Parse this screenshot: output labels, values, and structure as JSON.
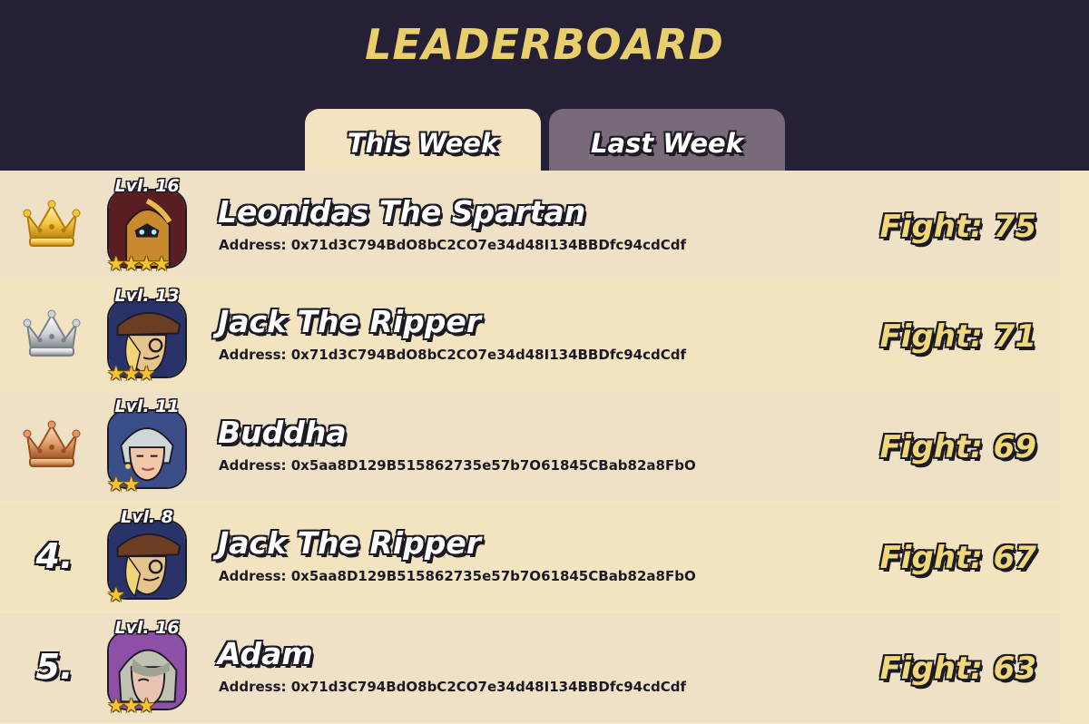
{
  "title": "LEADERBOARD",
  "tabs": {
    "this_week": "This Week",
    "last_week": "Last Week",
    "active": "this_week"
  },
  "colors": {
    "gold": "#e9cf6c",
    "silver": "#cfd3d8",
    "bronze": "#d9894f",
    "dark": "#252036"
  },
  "rows": [
    {
      "rank": "1",
      "crown": "gold-crown-icon",
      "level": "Lvl. 16",
      "stars": 4,
      "avatar": "spartan-helmet-avatar",
      "avatar_bg": "#5a1d22",
      "name": "Leonidas The Spartan",
      "address": "Address: 0x71d3C794BdO8bC2CO7e34d48I134BBDfc94cdCdf",
      "fight": "Fight: 75"
    },
    {
      "rank": "2",
      "crown": "silver-crown-icon",
      "level": "Lvl. 13",
      "stars": 3,
      "avatar": "ripper-avatar",
      "avatar_bg": "#29336a",
      "name": "Jack The Ripper",
      "address": "Address: 0x71d3C794BdO8bC2CO7e34d48I134BBDfc94cdCdf",
      "fight": "Fight: 71"
    },
    {
      "rank": "3",
      "crown": "bronze-crown-icon",
      "level": "Lvl. 11",
      "stars": 2,
      "avatar": "buddha-avatar",
      "avatar_bg": "#3a4e8a",
      "name": "Buddha",
      "address": "Address: 0x5aa8D129B515862735e57b7O61845CBab82a8FbO",
      "fight": "Fight: 69"
    },
    {
      "rank": "4.",
      "crown": "",
      "level": "Lvl. 8",
      "stars": 1,
      "avatar": "ripper-avatar",
      "avatar_bg": "#29336a",
      "name": "Jack The Ripper",
      "address": "Address: 0x5aa8D129B515862735e57b7O61845CBab82a8FbO",
      "fight": "Fight: 67"
    },
    {
      "rank": "5.",
      "crown": "",
      "level": "Lvl. 16",
      "stars": 3,
      "avatar": "adam-avatar",
      "avatar_bg": "#8d4fa8",
      "name": "Adam",
      "address": "Address: 0x71d3C794BdO8bC2CO7e34d48I134BBDfc94cdCdf",
      "fight": "Fight: 63"
    }
  ]
}
